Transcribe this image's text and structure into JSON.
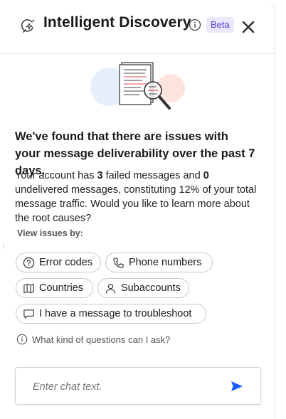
{
  "header": {
    "title": "Intelligent Discovery",
    "badge": "Beta",
    "icons": {
      "title_icon": "sparkle-search-icon",
      "info": "info-icon",
      "close": "close-icon"
    }
  },
  "illustration": {
    "icon": "document-magnifier-illustration"
  },
  "content": {
    "headline": "We've found that there are issues with your message deliverability over the past 7 days.",
    "para_1": "Your account has ",
    "failed_count": "3",
    "para_2": " failed messages and ",
    "undelivered_count": "0",
    "para_3": " undelivered messages, constituting 12% of your total message traffic. Would you like to learn more about the root causes?"
  },
  "view_issues": {
    "label": "View issues by:",
    "chips": [
      {
        "label": "Error codes",
        "icon": "question-circle-icon"
      },
      {
        "label": "Phone numbers",
        "icon": "phone-icon"
      },
      {
        "label": "Countries",
        "icon": "map-icon"
      },
      {
        "label": "Subaccounts",
        "icon": "user-icon"
      },
      {
        "label": "I have a message to troubleshoot",
        "icon": "chat-bubble-icon"
      }
    ]
  },
  "questions_link": "What kind of questions can I ask?",
  "chat": {
    "placeholder": "Enter chat text.",
    "send_icon": "send-icon"
  },
  "colors": {
    "accent": "#1a5cff",
    "beta_bg": "#ece8fb",
    "beta_text": "#5b3fd1",
    "border": "#e3e3e3"
  }
}
